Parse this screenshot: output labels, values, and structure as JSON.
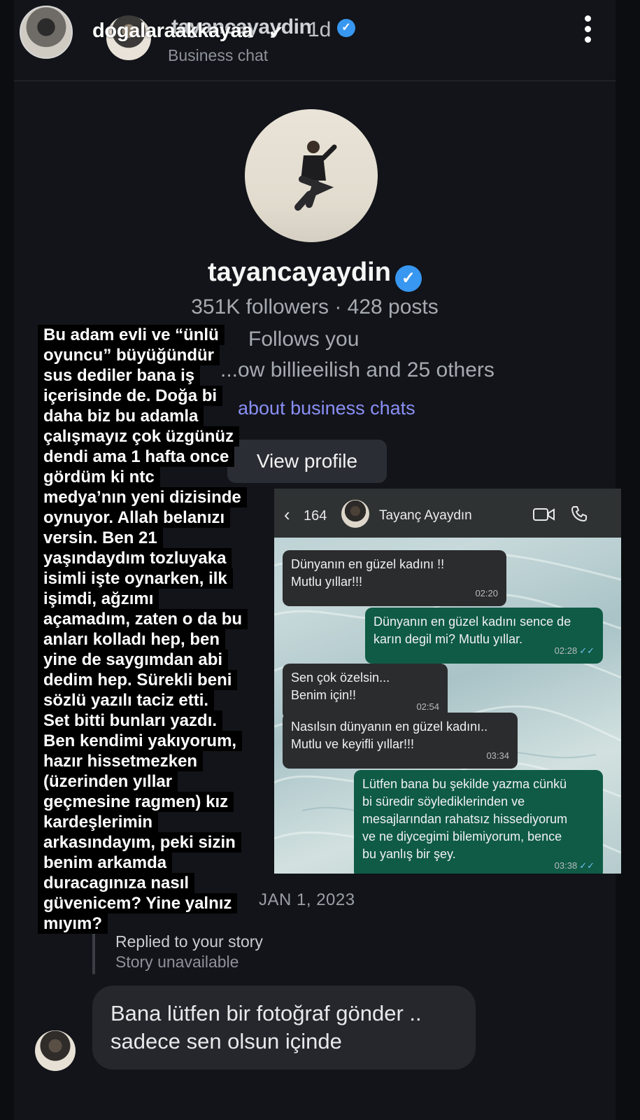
{
  "story": {
    "username": "dogalaraakkayaa",
    "verified_icon": "verified-icon",
    "time": "1d",
    "more_icon": "more-vertical-icon"
  },
  "dm": {
    "header": {
      "name": "tayancayaydin",
      "subtitle": "Business chat"
    },
    "profile": {
      "name": "tayancayaydin",
      "stats": "351K followers · 428 posts",
      "follows": "Follows you",
      "mutual": "...ow billieeilish and 25 others",
      "link": "about business chats",
      "view_profile": "View profile"
    },
    "date": "JAN 1, 2023",
    "reply": {
      "title": "Replied to your story",
      "subtitle": "Story unavailable"
    },
    "message": {
      "line1": "Bana lütfen bir fotoğraf gönder ..",
      "line2": "sadece sen olsun içinde"
    }
  },
  "caption": {
    "lines": [
      "Bu adam evli ve “ünlü",
      "oyuncu” büyüğündür",
      "sus dediler bana iş",
      "içerisinde de. Doğa bi",
      "daha biz bu adamla",
      "çalışmayız çok üzgünüz",
      "dendi ama 1 hafta once",
      "gördüm ki ntc",
      "medya’nın yeni dizisinde",
      "oynuyor. Allah belanızı",
      "versin. Ben 21",
      "yaşındaydım tozluyaka",
      "isimli işte oynarken, ilk",
      "işimdi, ağzımı",
      "açamadım, zaten o da bu",
      "anları kolladı hep, ben",
      "yine de saygımdan abi",
      "dedim hep. Sürekli beni",
      "sözlü yazılı taciz etti.",
      "Set bitti bunları yazdı.",
      "Ben kendimi yakıyorum,",
      "hazır hissetmezken",
      "(üzerinden yıllar",
      "geçmesine ragmen) kız",
      "kardeşlerimin",
      "arkasındayım, peki sizin",
      "benim arkamda",
      "duracagınıza nasıl",
      "güvenicem? Yine yalnız",
      "mıyım?"
    ]
  },
  "whatsapp": {
    "back_count": "164",
    "contact": "Tayanç Ayaydın",
    "messages": [
      {
        "dir": "in",
        "lines": [
          "Dünyanın en güzel kadını !!",
          "Mutlu yıllar!!!"
        ],
        "time": "02:20"
      },
      {
        "dir": "out",
        "lines": [
          "Dünyanın en güzel kadını sence de",
          "karın degil mi? Mutlu yıllar."
        ],
        "time": "02:28"
      },
      {
        "dir": "in",
        "lines": [
          "Sen çok özelsin...",
          "Benim için!!"
        ],
        "time": "02:54"
      },
      {
        "dir": "in",
        "lines": [
          "Nasılsın dünyanın en güzel kadını..",
          "Mutlu ve keyifli yıllar!!!"
        ],
        "time": "03:34"
      },
      {
        "dir": "out",
        "lines": [
          "Lütfen bana bu şekilde yazma cünkü",
          "bi süredir söylediklerinden ve",
          "mesajlarından rahatsız hissediyorum",
          "ve ne diycegimi bilemiyorum, bence",
          "bu yanlış bir şey."
        ],
        "time": "03:38"
      }
    ],
    "read_ticks": "✓✓"
  },
  "colors": {
    "background": "#0b0d11",
    "verified": "#3897f0",
    "link": "#8a8ff5",
    "wa_out": "#0f5b46",
    "wa_in": "#2b2c2e"
  }
}
